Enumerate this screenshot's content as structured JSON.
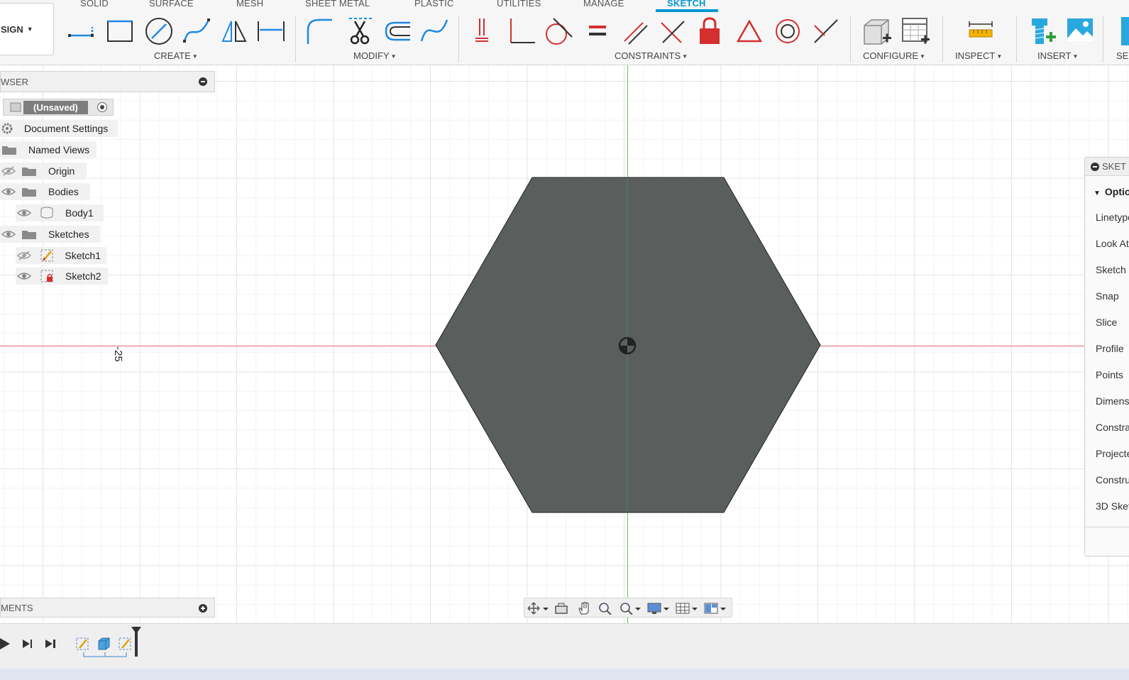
{
  "tabs": [
    {
      "label": "SOLID",
      "active": false
    },
    {
      "label": "SURFACE",
      "active": false
    },
    {
      "label": "MESH",
      "active": false
    },
    {
      "label": "SHEET METAL",
      "active": false
    },
    {
      "label": "PLASTIC",
      "active": false
    },
    {
      "label": "UTILITIES",
      "active": false
    },
    {
      "label": "MANAGE",
      "active": false
    },
    {
      "label": "SKETCH",
      "active": true
    }
  ],
  "workspace": {
    "label": "SIGN"
  },
  "groups": {
    "create": "CREATE",
    "modify": "MODIFY",
    "constraints": "CONSTRAINTS",
    "configure": "CONFIGURE",
    "inspect": "INSPECT",
    "insert": "INSERT",
    "select": "SE"
  },
  "browser": {
    "title": "WSER",
    "root": "(Unsaved)",
    "items": [
      {
        "label": "Document Settings",
        "icon": "gear-icon"
      },
      {
        "label": "Named Views",
        "icon": "folder-icon"
      },
      {
        "label": "Origin",
        "icon": "folder-icon",
        "visible": false
      },
      {
        "label": "Bodies",
        "icon": "folder-icon",
        "visible": true
      },
      {
        "label": "Body1",
        "icon": "body-icon",
        "visible": true
      },
      {
        "label": "Sketches",
        "icon": "folder-icon",
        "visible": true
      },
      {
        "label": "Sketch1",
        "icon": "sketch-icon",
        "visible": false
      },
      {
        "label": "Sketch2",
        "icon": "sketch-icon",
        "visible": true
      }
    ]
  },
  "comments": {
    "title": "MENTS"
  },
  "canvas": {
    "dimension_label": "-25",
    "shape": "hexagon",
    "shape_color": "#5a5f5e"
  },
  "palette": {
    "title": "SKET",
    "section": "Optio",
    "items": [
      "Linetype",
      "Look At",
      "Sketch",
      "Snap",
      "Slice",
      "Profile",
      "Points",
      "Dimens",
      "Constra",
      "Projecte",
      "Constru",
      "3D Sket"
    ]
  },
  "colors": {
    "accent": "#0696d7",
    "x_axis": "#d9534f",
    "y_axis": "#5cb85c",
    "constraint_red": "#d32f2f"
  }
}
